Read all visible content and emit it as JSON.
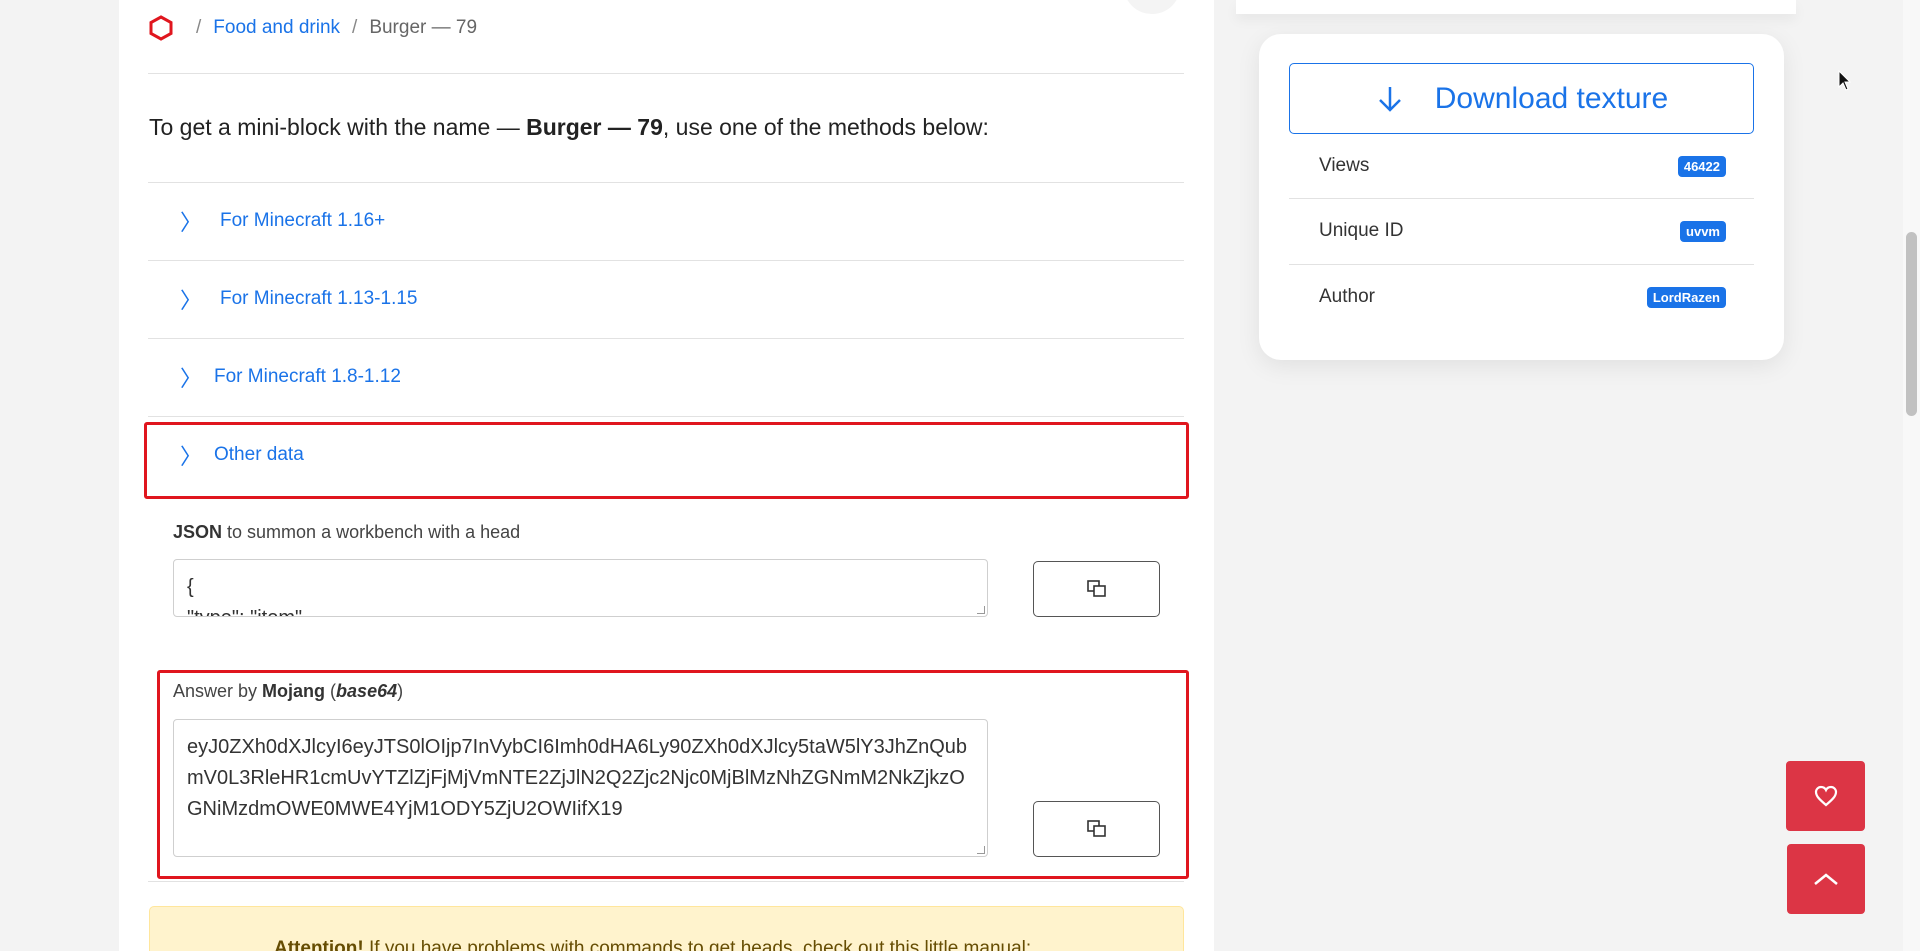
{
  "breadcrumb": {
    "category": "Food and drink",
    "current": "Burger — 79"
  },
  "intro": {
    "prefix": "To get a mini-block with the name — ",
    "name": "Burger — 79",
    "suffix": ", use one of the methods below:"
  },
  "accordion": [
    {
      "label": "For Minecraft 1.16+"
    },
    {
      "label": "For Minecraft 1.13-1.15"
    },
    {
      "label": "For Minecraft 1.8-1.12"
    },
    {
      "label": "Other data"
    }
  ],
  "json_field": {
    "label_bold": "JSON",
    "label_rest": " to summon a workbench with a head",
    "value_line1": "{",
    "value_line2": "\"type\": \"item\","
  },
  "mojang_field": {
    "label_prefix": "Answer by ",
    "label_bold": "Mojang",
    "label_open": " (",
    "label_italic": "base64",
    "label_close": ")",
    "value": "eyJ0ZXh0dXJlcyI6eyJTS0lOIjp7InVybCI6Imh0dHA6Ly90ZXh0dXJlcy5taW5lY3JhZnQubmV0L3RleHR1cmUvYTZlZjFjMjVmNTE2ZjJlN2Q2Zjc2Njc0MjBlMzNhZGNmM2NkZjkzOGNiMzdmOWE0MWE4YjM1ODY5ZjU2OWIifX19"
  },
  "attention": {
    "bold": "Attention!",
    "text": " If you have problems with commands to get heads, check out this little manual:"
  },
  "sidebar": {
    "download_label": "Download texture",
    "rows": [
      {
        "key": "Views",
        "value": "46422"
      },
      {
        "key": "Unique ID",
        "value": "uvvm"
      },
      {
        "key": "Author",
        "value": "LordRazen"
      }
    ]
  },
  "colors": {
    "accent": "#1a73e8",
    "danger": "#dc3545",
    "highlight": "#e0161e",
    "warning_bg": "#fff3cd"
  },
  "icons": [
    "logo-icon",
    "chevron-right-icon",
    "copy-icon",
    "arrow-down-icon",
    "heart-icon",
    "chevron-up-icon",
    "mouse-cursor-icon"
  ]
}
